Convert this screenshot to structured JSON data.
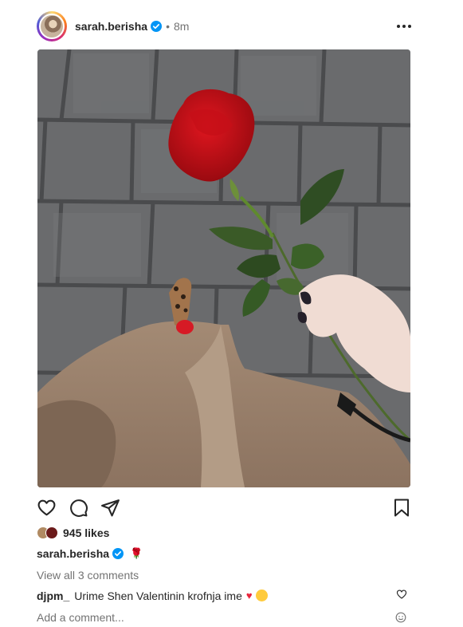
{
  "post": {
    "username": "sarah.berisha",
    "separator": "•",
    "time": "8m",
    "likes_text": "945 likes",
    "caption_user": "sarah.berisha",
    "caption_emoji": "🌹",
    "view_all": "View all 3 comments",
    "comment": {
      "user": "djpm_",
      "text": "Urime Shen Valentinin krofnja ime"
    },
    "add_comment_placeholder": "Add a comment..."
  },
  "icons": {
    "more": "more-options-icon",
    "like": "heart-icon",
    "comment": "comment-icon",
    "share": "share-icon",
    "save": "bookmark-icon",
    "verified": "verified-badge-icon",
    "emoji": "emoji-icon"
  },
  "colors": {
    "verified": "#0095f6",
    "heart": "#e8243b",
    "muted": "#737373"
  }
}
